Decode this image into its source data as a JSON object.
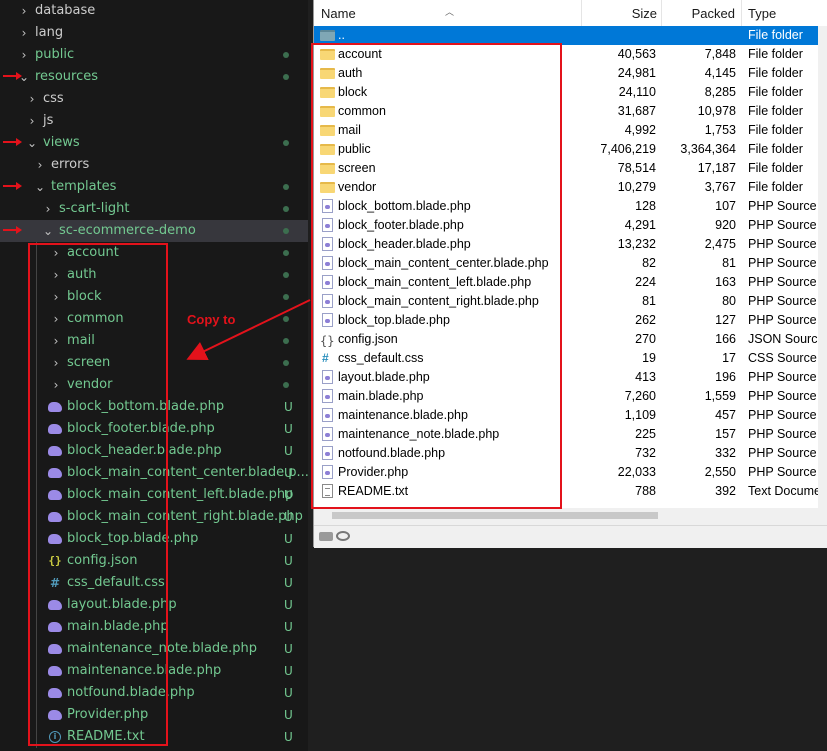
{
  "explorer": {
    "rows": [
      {
        "label": "database",
        "chev": "›",
        "indent": 1,
        "color": "white",
        "status": ""
      },
      {
        "label": "lang",
        "chev": "›",
        "indent": 1,
        "color": "white",
        "status": ""
      },
      {
        "label": "public",
        "chev": "›",
        "indent": 1,
        "color": "green",
        "status": "dot"
      },
      {
        "label": "resources",
        "chev": "⌄",
        "indent": 1,
        "color": "green",
        "status": "dot"
      },
      {
        "label": "css",
        "chev": "›",
        "indent": 2,
        "color": "white",
        "status": ""
      },
      {
        "label": "js",
        "chev": "›",
        "indent": 2,
        "color": "white",
        "status": ""
      },
      {
        "label": "views",
        "chev": "⌄",
        "indent": 2,
        "color": "green",
        "status": "dot"
      },
      {
        "label": "errors",
        "chev": "›",
        "indent": 3,
        "color": "white",
        "status": ""
      },
      {
        "label": "templates",
        "chev": "⌄",
        "indent": 3,
        "color": "green",
        "status": "dot"
      },
      {
        "label": "s-cart-light",
        "chev": "›",
        "indent": 4,
        "color": "green",
        "status": "dot"
      },
      {
        "label": "sc-ecommerce-demo",
        "chev": "⌄",
        "indent": 4,
        "color": "green",
        "status": "dot"
      },
      {
        "label": "account",
        "chev": "›",
        "indent": 5,
        "color": "green",
        "status": "dot"
      },
      {
        "label": "auth",
        "chev": "›",
        "indent": 5,
        "color": "green",
        "status": "dot"
      },
      {
        "label": "block",
        "chev": "›",
        "indent": 5,
        "color": "green",
        "status": "dot"
      },
      {
        "label": "common",
        "chev": "›",
        "indent": 5,
        "color": "green",
        "status": "dot"
      },
      {
        "label": "mail",
        "chev": "›",
        "indent": 5,
        "color": "green",
        "status": "dot"
      },
      {
        "label": "screen",
        "chev": "›",
        "indent": 5,
        "color": "green",
        "status": "dot"
      },
      {
        "label": "vendor",
        "chev": "›",
        "indent": 5,
        "color": "green",
        "status": "dot"
      },
      {
        "label": "block_bottom.blade.php",
        "icon": "php",
        "indent": 5,
        "color": "green",
        "status": "U"
      },
      {
        "label": "block_footer.blade.php",
        "icon": "php",
        "indent": 5,
        "color": "green",
        "status": "U"
      },
      {
        "label": "block_header.blade.php",
        "icon": "php",
        "indent": 5,
        "color": "green",
        "status": "U"
      },
      {
        "label": "block_main_content_center.blade.p...",
        "icon": "php",
        "indent": 5,
        "color": "green",
        "status": "U"
      },
      {
        "label": "block_main_content_left.blade.php",
        "icon": "php",
        "indent": 5,
        "color": "green",
        "status": "U"
      },
      {
        "label": "block_main_content_right.blade.php",
        "icon": "php",
        "indent": 5,
        "color": "green",
        "status": "U"
      },
      {
        "label": "block_top.blade.php",
        "icon": "php",
        "indent": 5,
        "color": "green",
        "status": "U"
      },
      {
        "label": "config.json",
        "icon": "json",
        "indent": 5,
        "color": "green",
        "status": "U"
      },
      {
        "label": "css_default.css",
        "icon": "css",
        "indent": 5,
        "color": "green",
        "status": "U"
      },
      {
        "label": "layout.blade.php",
        "icon": "php",
        "indent": 5,
        "color": "green",
        "status": "U"
      },
      {
        "label": "main.blade.php",
        "icon": "php",
        "indent": 5,
        "color": "green",
        "status": "U"
      },
      {
        "label": "maintenance_note.blade.php",
        "icon": "php",
        "indent": 5,
        "color": "green",
        "status": "U"
      },
      {
        "label": "maintenance.blade.php",
        "icon": "php",
        "indent": 5,
        "color": "green",
        "status": "U"
      },
      {
        "label": "notfound.blade.php",
        "icon": "php",
        "indent": 5,
        "color": "green",
        "status": "U"
      },
      {
        "label": "Provider.php",
        "icon": "php",
        "indent": 5,
        "color": "green",
        "status": "U"
      },
      {
        "label": "README.txt",
        "icon": "info",
        "indent": 5,
        "color": "green",
        "status": "U"
      }
    ]
  },
  "filemanager": {
    "columns": {
      "name": "Name",
      "size": "Size",
      "packed": "Packed",
      "type": "Type"
    },
    "rows": [
      {
        "name": "..",
        "size": "",
        "packed": "",
        "type": "File folder",
        "icon": "up"
      },
      {
        "name": "account",
        "size": "40,563",
        "packed": "7,848",
        "type": "File folder",
        "icon": "folder"
      },
      {
        "name": "auth",
        "size": "24,981",
        "packed": "4,145",
        "type": "File folder",
        "icon": "folder"
      },
      {
        "name": "block",
        "size": "24,110",
        "packed": "8,285",
        "type": "File folder",
        "icon": "folder"
      },
      {
        "name": "common",
        "size": "31,687",
        "packed": "10,978",
        "type": "File folder",
        "icon": "folder"
      },
      {
        "name": "mail",
        "size": "4,992",
        "packed": "1,753",
        "type": "File folder",
        "icon": "folder"
      },
      {
        "name": "public",
        "size": "7,406,219",
        "packed": "3,364,364",
        "type": "File folder",
        "icon": "folder"
      },
      {
        "name": "screen",
        "size": "78,514",
        "packed": "17,187",
        "type": "File folder",
        "icon": "folder"
      },
      {
        "name": "vendor",
        "size": "10,279",
        "packed": "3,767",
        "type": "File folder",
        "icon": "folder"
      },
      {
        "name": "block_bottom.blade.php",
        "size": "128",
        "packed": "107",
        "type": "PHP Source F",
        "icon": "php"
      },
      {
        "name": "block_footer.blade.php",
        "size": "4,291",
        "packed": "920",
        "type": "PHP Source F",
        "icon": "php"
      },
      {
        "name": "block_header.blade.php",
        "size": "13,232",
        "packed": "2,475",
        "type": "PHP Source F",
        "icon": "php"
      },
      {
        "name": "block_main_content_center.blade.php",
        "size": "82",
        "packed": "81",
        "type": "PHP Source F",
        "icon": "php"
      },
      {
        "name": "block_main_content_left.blade.php",
        "size": "224",
        "packed": "163",
        "type": "PHP Source F",
        "icon": "php"
      },
      {
        "name": "block_main_content_right.blade.php",
        "size": "81",
        "packed": "80",
        "type": "PHP Source F",
        "icon": "php"
      },
      {
        "name": "block_top.blade.php",
        "size": "262",
        "packed": "127",
        "type": "PHP Source F",
        "icon": "php"
      },
      {
        "name": "config.json",
        "size": "270",
        "packed": "166",
        "type": "JSON Source",
        "icon": "json"
      },
      {
        "name": "css_default.css",
        "size": "19",
        "packed": "17",
        "type": "CSS Source F",
        "icon": "css"
      },
      {
        "name": "layout.blade.php",
        "size": "413",
        "packed": "196",
        "type": "PHP Source F",
        "icon": "php"
      },
      {
        "name": "main.blade.php",
        "size": "7,260",
        "packed": "1,559",
        "type": "PHP Source F",
        "icon": "php"
      },
      {
        "name": "maintenance.blade.php",
        "size": "1,109",
        "packed": "457",
        "type": "PHP Source F",
        "icon": "php"
      },
      {
        "name": "maintenance_note.blade.php",
        "size": "225",
        "packed": "157",
        "type": "PHP Source F",
        "icon": "php"
      },
      {
        "name": "notfound.blade.php",
        "size": "732",
        "packed": "332",
        "type": "PHP Source F",
        "icon": "php"
      },
      {
        "name": "Provider.php",
        "size": "22,033",
        "packed": "2,550",
        "type": "PHP Source F",
        "icon": "php"
      },
      {
        "name": "README.txt",
        "size": "788",
        "packed": "392",
        "type": "Text Docume",
        "icon": "txt"
      }
    ]
  },
  "annotation": {
    "copy_to": "Copy to",
    "color": "#e3121b"
  },
  "colors": {
    "vscode_bg": "#181818",
    "git_added": "#73c991",
    "selection_blue": "#0078d7"
  }
}
